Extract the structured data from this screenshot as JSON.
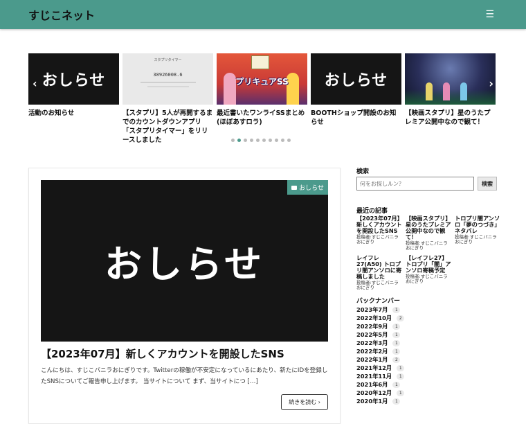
{
  "header": {
    "site_title": "すじこネット",
    "menu_icon": "hamburger-icon"
  },
  "carousel": {
    "slides": [
      {
        "thumb_text": "おしらせ",
        "caption": "活動のお知らせ"
      },
      {
        "thumb_title": "スタプリタイマー",
        "thumb_number": "38926008.6",
        "caption": "【スタプリ】5人が再開するまでのカウントダウンアプリ「スタプリタイマー」をリリースしました"
      },
      {
        "thumb_text": "プリキュアSS",
        "caption": "最近書いたワンライSSまとめ(ほぼあすロラ)"
      },
      {
        "thumb_text": "おしらせ",
        "caption": "BOOTHショップ開設のお知らせ"
      },
      {
        "caption": "【映画スタプリ】星のうたプレミア公開中なので観て！"
      }
    ],
    "prev_icon": "chevron-left-icon",
    "next_icon": "chevron-right-icon",
    "dot_count": 10,
    "active_dot": 1
  },
  "main_post": {
    "image_text": "おしらせ",
    "category": "おしらせ",
    "category_icon": "folder-icon",
    "title": "【2023年07月】新しくアカウントを開設したSNS",
    "excerpt": "こんにちは、すじこバニラおにぎりです。Twitterの稼働が不安定になっているにあたり、新たにIDを登録したSNSについてご報告申し上げます。 当サイトについて まず、当サイトにつ […]",
    "read_more": "続きを読む",
    "read_more_icon": "chevron-right-icon"
  },
  "sidebar": {
    "search": {
      "title": "検索",
      "placeholder": "何をお探しルン？",
      "button": "検索"
    },
    "recent": {
      "title": "最近の記事",
      "items": [
        {
          "title": "【2023年07月】新しくアカウントを開設したSNS",
          "meta": "投稿者:すじこバニラおにぎり"
        },
        {
          "title": "【映画スタプリ】星のうたプレミア公開中なので観て！",
          "meta": "投稿者:すじこバニラおにぎり"
        },
        {
          "title": "トロプリ闇アンソロ「夢のつづき」ネタバレ",
          "meta": "投稿者:すじこバニラおにぎり"
        },
        {
          "title": "レイフレ27(A50) トロプリ闇アンソロに寄稿しました",
          "meta": "投稿者:すじこバニラおにぎり"
        },
        {
          "title": "【レイフレ27】トロプリ「闇」アンソロ寄稿予定",
          "meta": "投稿者:すじこバニラおにぎり"
        }
      ]
    },
    "archive": {
      "title": "バックナンバー",
      "items": [
        {
          "label": "2023年7月",
          "count": "1"
        },
        {
          "label": "2022年10月",
          "count": "2"
        },
        {
          "label": "2022年9月",
          "count": "1"
        },
        {
          "label": "2022年5月",
          "count": "1"
        },
        {
          "label": "2022年3月",
          "count": "1"
        },
        {
          "label": "2022年2月",
          "count": "1"
        },
        {
          "label": "2022年1月",
          "count": "2"
        },
        {
          "label": "2021年12月",
          "count": "1"
        },
        {
          "label": "2021年11月",
          "count": "1"
        },
        {
          "label": "2021年6月",
          "count": "1"
        },
        {
          "label": "2020年12月",
          "count": "1"
        },
        {
          "label": "2020年1月",
          "count": "1"
        }
      ]
    }
  }
}
